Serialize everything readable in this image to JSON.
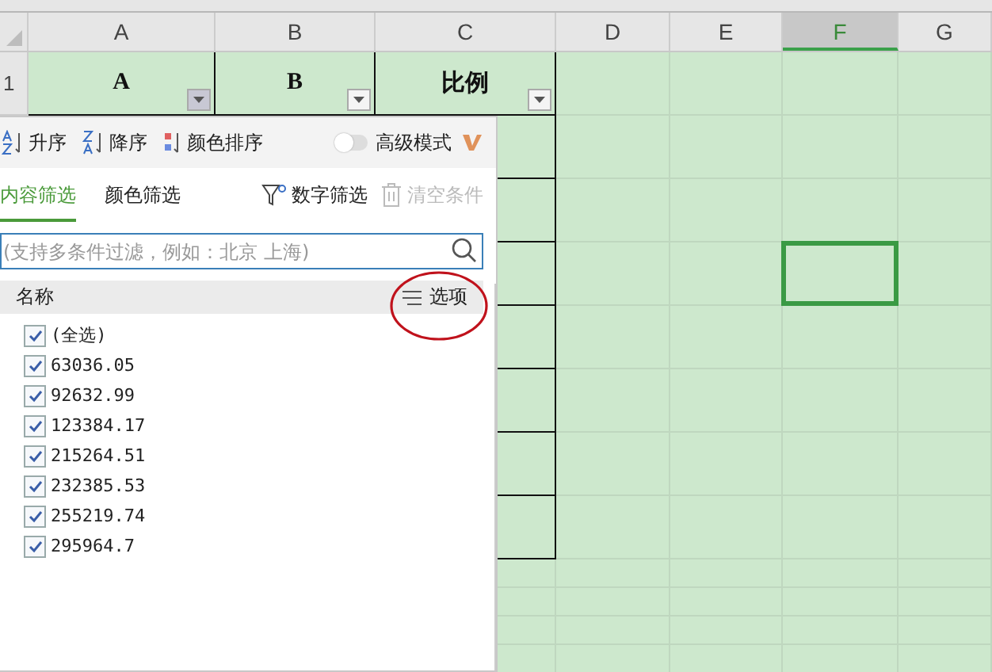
{
  "sheet": {
    "columns": [
      {
        "label": "A",
        "selected": false
      },
      {
        "label": "B",
        "selected": false
      },
      {
        "label": "C",
        "selected": false
      },
      {
        "label": "D",
        "selected": false
      },
      {
        "label": "E",
        "selected": false
      },
      {
        "label": "F",
        "selected": true
      },
      {
        "label": "G",
        "selected": false
      }
    ],
    "row_label": "1",
    "header_cells": [
      "A",
      "B",
      "比例"
    ]
  },
  "filter_panel": {
    "sort_buttons": [
      {
        "kind": "ascending",
        "label": "升序"
      },
      {
        "kind": "descending",
        "label": "降序"
      },
      {
        "kind": "color",
        "label": "颜色排序"
      }
    ],
    "advanced_mode": {
      "label": "高级模式",
      "on": false
    },
    "tabs": [
      {
        "label": "内容筛选",
        "selected": true
      },
      {
        "label": "颜色筛选",
        "selected": false
      }
    ],
    "number_filter": "数字筛选",
    "clear": {
      "label": "清空条件",
      "disabled": true
    },
    "search": {
      "placeholder": "(支持多条件过滤，例如：北京 上海)"
    },
    "list_header": "名称",
    "options": "选项",
    "items": [
      {
        "label": "(全选)",
        "checked": true
      },
      {
        "label": "63036.05",
        "checked": true
      },
      {
        "label": "92632.99",
        "checked": true
      },
      {
        "label": "123384.17",
        "checked": true
      },
      {
        "label": "215264.51",
        "checked": true
      },
      {
        "label": "232385.53",
        "checked": true
      },
      {
        "label": "255219.74",
        "checked": true
      },
      {
        "label": "295964.7",
        "checked": true
      }
    ]
  }
}
